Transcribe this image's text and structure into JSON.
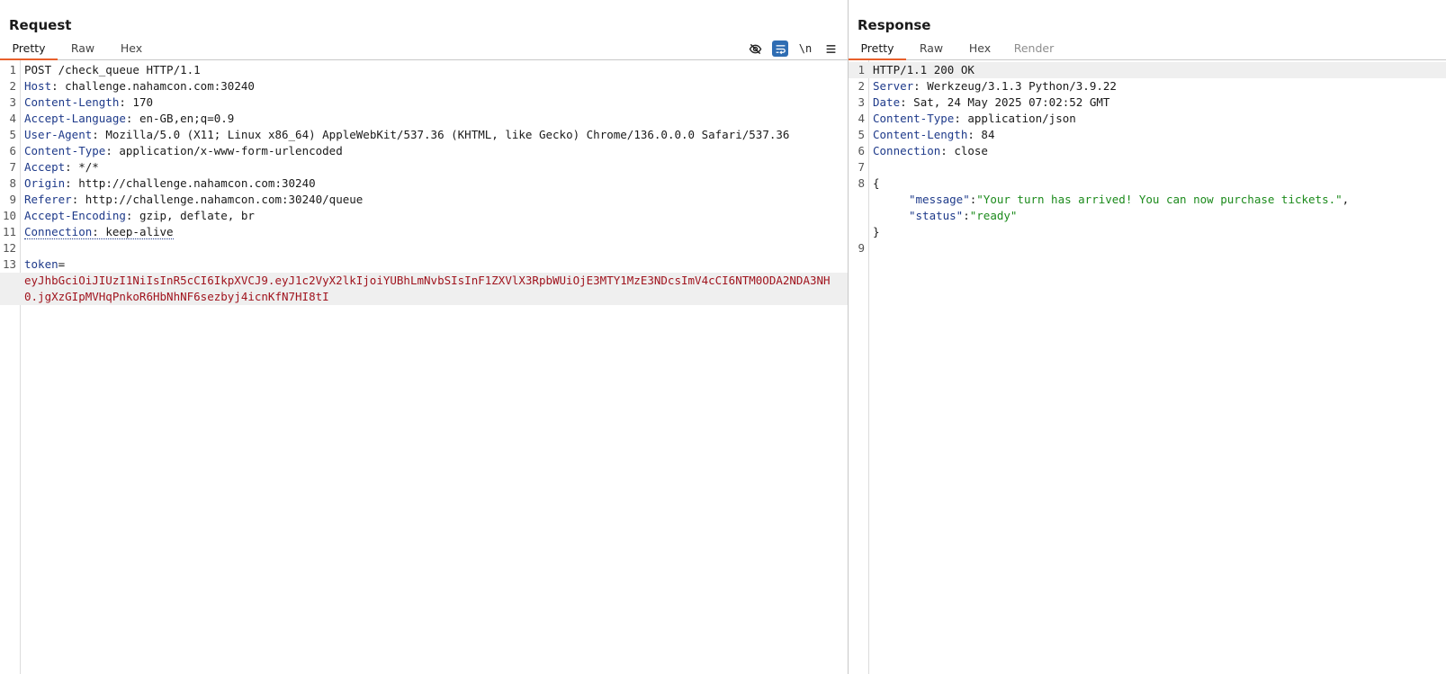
{
  "request": {
    "title": "Request",
    "tabs": [
      "Pretty",
      "Raw",
      "Hex"
    ],
    "active_tab": "Pretty",
    "toolbar": {
      "hide_icon": "eye-slash-icon",
      "wrap_icon": "wrap-lines-icon",
      "newline_label": "\\n",
      "menu_icon": "hamburger-menu-icon"
    },
    "lines": {
      "l1": "POST /check_queue HTTP/1.1",
      "host_name": "Host",
      "host_val": "challenge.nahamcon.com:30240",
      "cl_name": "Content-Length",
      "cl_val": "170",
      "al_name": "Accept-Language",
      "al_val": "en-GB,en;q=0.9",
      "ua_name": "User-Agent",
      "ua_val": "Mozilla/5.0 (X11; Linux x86_64) AppleWebKit/537.36 (KHTML, like Gecko) Chrome/136.0.0.0 Safari/537.36",
      "ct_name": "Content-Type",
      "ct_val": "application/x-www-form-urlencoded",
      "acc_name": "Accept",
      "acc_val": "*/*",
      "origin_name": "Origin",
      "origin_val": "http://challenge.nahamcon.com:30240",
      "ref_name": "Referer",
      "ref_val": "http://challenge.nahamcon.com:30240/queue",
      "ae_name": "Accept-Encoding",
      "ae_val": "gzip, deflate, br",
      "conn_name": "Connection",
      "conn_val": "keep-alive",
      "param_name": "token",
      "param_val": "eyJhbGciOiJIUzI1NiIsInR5cCI6IkpXVCJ9.eyJ1c2VyX2lkIjoiYUBhLmNvbSIsInF1ZXVlX3RpbWUiOjE3MTY1MzE3NDcsImV4cCI6NTM0ODA2NDA3NH0.jgXzGIpMVHqPnkoR6HbNhNF6sezbyj4icnKfN7HI8tI"
    },
    "line_numbers": [
      "1",
      "2",
      "3",
      "4",
      "5",
      "6",
      "7",
      "8",
      "9",
      "10",
      "11",
      "12",
      "13"
    ]
  },
  "response": {
    "title": "Response",
    "tabs": [
      "Pretty",
      "Raw",
      "Hex",
      "Render"
    ],
    "active_tab": "Pretty",
    "lines": {
      "status": "HTTP/1.1 200 OK",
      "server_name": "Server",
      "server_val": "Werkzeug/3.1.3 Python/3.9.22",
      "date_name": "Date",
      "date_val": "Sat, 24 May 2025 07:02:52 GMT",
      "ct_name": "Content-Type",
      "ct_val": "application/json",
      "cl_name": "Content-Length",
      "cl_val": "84",
      "conn_name": "Connection",
      "conn_val": "close",
      "brace_open": "{",
      "msg_key": "\"message\"",
      "msg_val": "\"Your turn has arrived! You can now purchase tickets.\"",
      "status_key": "\"status\"",
      "status_val": "\"ready\"",
      "brace_close": "}"
    },
    "line_numbers": [
      "1",
      "2",
      "3",
      "4",
      "5",
      "6",
      "7",
      "8",
      "9"
    ]
  },
  "colors": {
    "active_tab_underline": "#e8602c",
    "header_name": "#1e3a8a",
    "token_value": "#a0141e",
    "json_string": "#1b8a1b",
    "toggle_on": "#2f6db3"
  }
}
